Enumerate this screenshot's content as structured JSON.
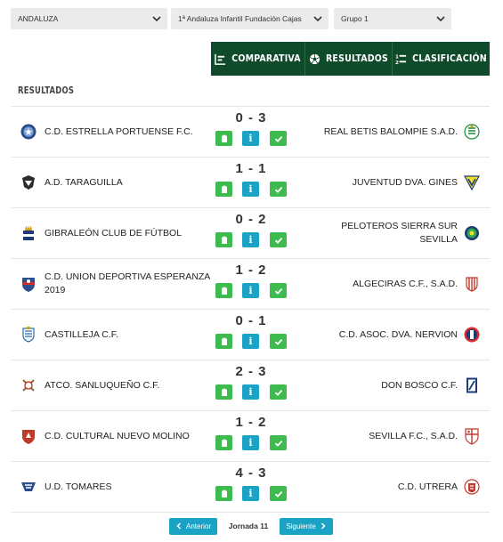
{
  "filters": [
    {
      "value": "ANDALUZA"
    },
    {
      "value": "1ª Andaluza Infantil Fundación Cajas"
    },
    {
      "value": "Grupo 1"
    }
  ],
  "tabs": [
    {
      "label": "COMPARATIVA",
      "icon": "chart-bars-icon"
    },
    {
      "label": "RESULTADOS",
      "icon": "soccer-ball-icon"
    },
    {
      "label": "CLASIFICACIÓN",
      "icon": "ranking-icon"
    }
  ],
  "section_title": "RESULTADOS",
  "matches": [
    {
      "home": "C.D. ESTRELLA PORTUENSE F.C.",
      "score": "0 - 3",
      "away": "REAL BETIS BALOMPIE S.A.D."
    },
    {
      "home": "A.D. TARAGUILLA",
      "score": "1 - 1",
      "away": "JUVENTUD DVA. GINES"
    },
    {
      "home": "GIBRALEÓN CLUB DE FÚTBOL",
      "score": "0 - 2",
      "away": "PELOTEROS SIERRA SUR SEVILLA"
    },
    {
      "home": "C.D. UNION DEPORTIVA ESPERANZA 2019",
      "score": "1 - 2",
      "away": "ALGECIRAS C.F., S.A.D."
    },
    {
      "home": "CASTILLEJA C.F.",
      "score": "0 - 1",
      "away": "C.D. ASOC. DVA. NERVION"
    },
    {
      "home": "ATCO. SANLUQUEÑO C.F.",
      "score": "2 - 3",
      "away": "DON BOSCO C.F."
    },
    {
      "home": "C.D. CULTURAL NUEVO MOLINO",
      "score": "1 - 2",
      "away": "SEVILLA F.C., S.A.D."
    },
    {
      "home": "U.D. TOMARES",
      "score": "4 - 3",
      "away": "C.D. UTRERA"
    }
  ],
  "match_buttons": {
    "report_icon": "clipboard-icon",
    "info_label": "i",
    "check_icon": "check-icon"
  },
  "pager": {
    "prev_label": "Anterior",
    "jornada_label": "Jornada 11",
    "next_label": "Siguiente"
  },
  "colors": {
    "tab_bg": "#0f4a2a",
    "action_green": "#3dbb4f",
    "info_blue": "#1aa3c4"
  }
}
